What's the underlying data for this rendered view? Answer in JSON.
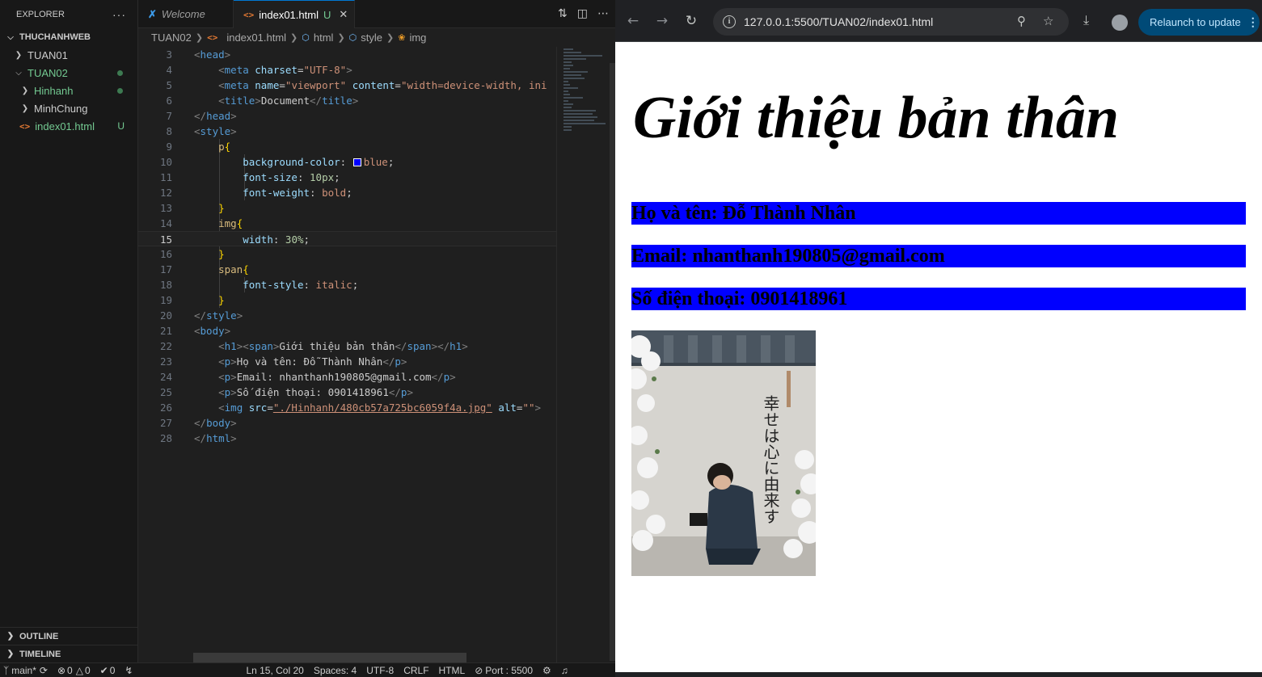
{
  "explorer": {
    "title": "EXPLORER",
    "more": "···",
    "root": "THUCHANHWEB",
    "items": [
      {
        "label": "TUAN01"
      },
      {
        "label": "TUAN02"
      },
      {
        "label": "Hinhanh"
      },
      {
        "label": "MinhChung"
      },
      {
        "label": "index01.html",
        "badge": "U"
      }
    ],
    "outline": "OUTLINE",
    "timeline": "TIMELINE"
  },
  "tabs": [
    {
      "label": "Welcome"
    },
    {
      "label": "index01.html",
      "badge": "U"
    }
  ],
  "breadcrumb": [
    "TUAN02",
    "index01.html",
    "html",
    "style",
    "img"
  ],
  "editor": {
    "current_line": 15,
    "lines": [
      {
        "n": "3"
      },
      {
        "n": "4"
      },
      {
        "n": "5"
      },
      {
        "n": "6"
      },
      {
        "n": "7"
      },
      {
        "n": "8"
      },
      {
        "n": "9"
      },
      {
        "n": "10"
      },
      {
        "n": "11"
      },
      {
        "n": "12"
      },
      {
        "n": "13"
      },
      {
        "n": "14"
      },
      {
        "n": "15"
      },
      {
        "n": "16"
      },
      {
        "n": "17"
      },
      {
        "n": "18"
      },
      {
        "n": "19"
      },
      {
        "n": "20"
      },
      {
        "n": "21"
      },
      {
        "n": "22"
      },
      {
        "n": "23"
      },
      {
        "n": "24"
      },
      {
        "n": "25"
      },
      {
        "n": "26"
      },
      {
        "n": "27"
      },
      {
        "n": "28"
      }
    ],
    "code": {
      "l3": "head",
      "l4_tag": "meta",
      "l4_attr": "charset",
      "l4_val": "\"UTF-8\"",
      "l5_tag": "meta",
      "l5_attr1": "name",
      "l5_val1": "\"viewport\"",
      "l5_attr2": "content",
      "l5_val2": "\"width=device-width, ini",
      "l6_tag": "title",
      "l6_text": "Document",
      "l7": "head",
      "l8": "style",
      "l9": "p",
      "l10_prop": "background-color",
      "l10_val": "blue",
      "l11_prop": "font-size",
      "l11_val": "10px",
      "l12_prop": "font-weight",
      "l12_val": "bold",
      "l14": "img",
      "l15_prop": "width",
      "l15_val": "30%",
      "l17": "span",
      "l18_prop": "font-style",
      "l18_val": "italic",
      "l20": "style",
      "l21": "body",
      "l22_text": "Giới thiệu bản thân",
      "l23_text": "Họ và tên: Đỗ Thành Nhân",
      "l24_text": "Email: nhanthanh190805@gmail.com",
      "l25_text": "Số điện thoại: 0901418961",
      "l26_src": "\"./Hinhanh/480cb57a725bc6059f4a.jpg\"",
      "l26_alt": "\"\"",
      "l27": "body",
      "l28": "html"
    }
  },
  "statusbar": {
    "branch": "main*",
    "errors": "0",
    "warnings": "0",
    "ports": "0",
    "position": "Ln 15, Col 20",
    "spaces": "Spaces: 4",
    "encoding": "UTF-8",
    "eol": "CRLF",
    "language": "HTML",
    "port": "Port : 5500"
  },
  "browser": {
    "url": "127.0.0.1:5500/TUAN02/index01.html",
    "relaunch": "Relaunch to update"
  },
  "page": {
    "heading": "Giới thiệu bản thân",
    "name": "Họ và tên: Đỗ Thành Nhân",
    "email": "Email: nhanthanh190805@gmail.com",
    "phone": "Số điện thoại: 0901418961",
    "photo_text": "幸せは心に由来す"
  },
  "colors": {
    "paragraph_bg": "#0000ff",
    "accent": "#0078d4",
    "untracked": "#73c991"
  }
}
